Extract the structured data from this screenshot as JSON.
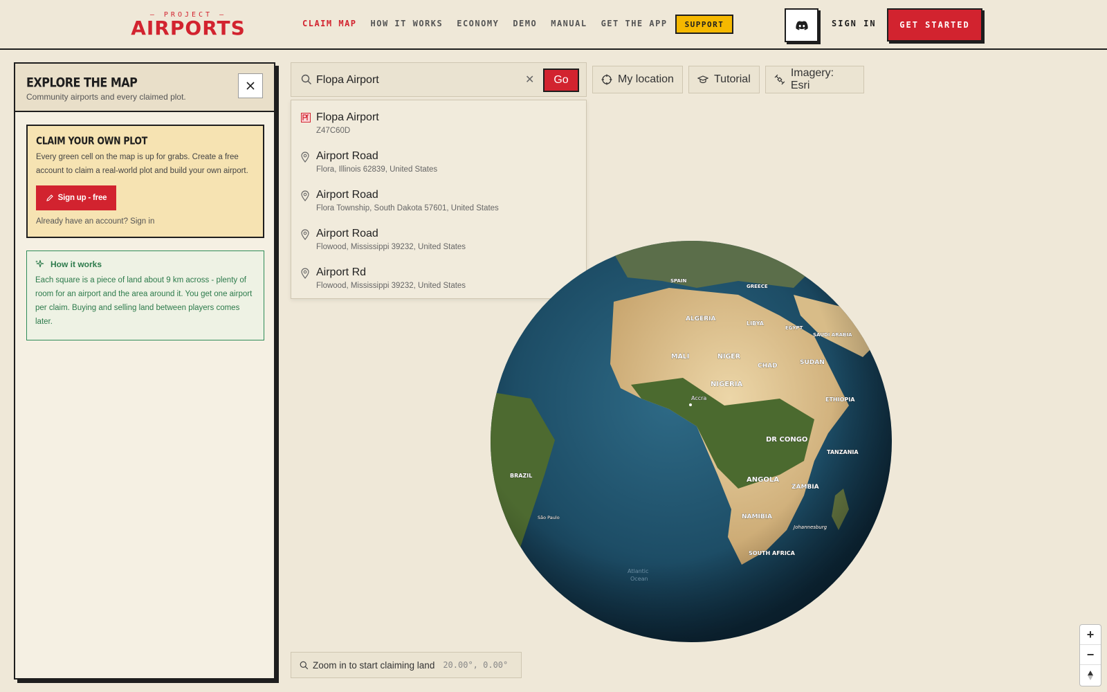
{
  "brand": {
    "top": "— PROJECT —",
    "name": "AIRPORTS"
  },
  "nav": {
    "items": [
      "CLAIM MAP",
      "HOW IT WORKS",
      "ECONOMY",
      "DEMO",
      "MANUAL",
      "GET THE APP"
    ],
    "support": "SUPPORT",
    "sign_in": "SIGN IN",
    "get_started": "GET STARTED"
  },
  "panel": {
    "title": "EXPLORE THE MAP",
    "subtitle": "Community airports and every claimed plot.",
    "claim": {
      "title": "CLAIM YOUR OWN PLOT",
      "text": "Every green cell on the map is up for grabs. Create a free account to claim a real-world plot and build your own airport.",
      "button": "Sign up - free",
      "already": "Already have an account? Sign in"
    },
    "how": {
      "title": "How it works",
      "text": "Each square is a piece of land about 9 km across - plenty of room for an airport and the area around it. You get one airport per claim. Buying and selling land between players comes later."
    }
  },
  "search": {
    "value": "Flopa Airport",
    "go": "Go",
    "results": [
      {
        "title": "Flopa Airport",
        "sub": "Z47C60D",
        "icon": "airport-icon"
      },
      {
        "title": "Airport Road",
        "sub": "Flora, Illinois 62839, United States",
        "icon": "pin-icon"
      },
      {
        "title": "Airport Road",
        "sub": "Flora Township, South Dakota 57601, United States",
        "icon": "pin-icon"
      },
      {
        "title": "Airport Road",
        "sub": "Flowood, Mississippi 39232, United States",
        "icon": "pin-icon"
      },
      {
        "title": "Airport Rd",
        "sub": "Flowood, Mississippi 39232, United States",
        "icon": "pin-icon"
      }
    ]
  },
  "tools": {
    "my_location": "My location",
    "tutorial": "Tutorial",
    "imagery": "Imagery: Esri"
  },
  "map_labels": {
    "spain": "SPAIN",
    "greece": "GREECE",
    "algeria": "ALGERIA",
    "libya": "LIBYA",
    "egypt": "EGYPT",
    "saudi": "SAUDI ARABIA",
    "mali": "MALI",
    "niger": "NIGER",
    "chad": "CHAD",
    "sudan": "SUDAN",
    "nigeria": "NIGERIA",
    "accra": "Accra",
    "ethiopia": "ETHIOPIA",
    "drcongo": "DR CONGO",
    "tanzania": "TANZANIA",
    "brazil": "BRAZIL",
    "angola": "ANGOLA",
    "zambia": "ZAMBIA",
    "saopaulo": "São Paulo",
    "namibia": "NAMIBIA",
    "johannesburg": "Johannesburg",
    "southafrica": "SOUTH AFRICA",
    "atlantic1": "Atlantic",
    "atlantic2": "Ocean"
  },
  "status": {
    "text": "Zoom in to start claiming land",
    "coords": "20.00°, 0.00°"
  },
  "zoom": {
    "in": "+",
    "out": "−"
  },
  "colors": {
    "accent": "#d2232f",
    "support": "#f5b800",
    "green": "#2c7a4b"
  }
}
